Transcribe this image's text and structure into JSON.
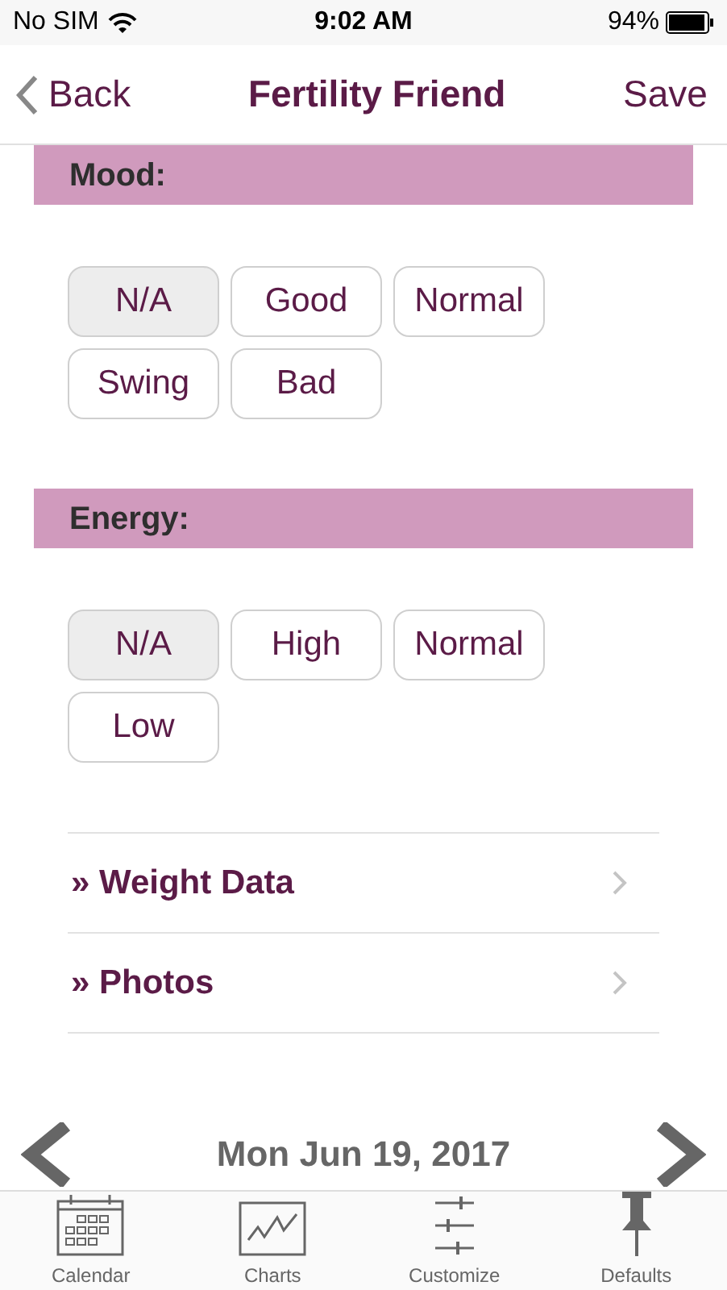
{
  "status_bar": {
    "carrier": "No SIM",
    "time": "9:02 AM",
    "battery": "94%"
  },
  "nav": {
    "back": "Back",
    "title": "Fertility Friend",
    "action": "Save"
  },
  "sections": [
    {
      "title": "Mood:",
      "options": [
        {
          "label": "N/A",
          "selected": true
        },
        {
          "label": "Good",
          "selected": false
        },
        {
          "label": "Normal",
          "selected": false
        },
        {
          "label": "Swing",
          "selected": false
        },
        {
          "label": "Bad",
          "selected": false
        }
      ]
    },
    {
      "title": "Energy:",
      "options": [
        {
          "label": "N/A",
          "selected": true
        },
        {
          "label": "High",
          "selected": false
        },
        {
          "label": "Normal",
          "selected": false
        },
        {
          "label": "Low",
          "selected": false
        }
      ]
    }
  ],
  "links": [
    {
      "label": "» Weight Data"
    },
    {
      "label": "» Photos"
    }
  ],
  "date": "Mon Jun 19, 2017",
  "tabs": [
    {
      "kind": "calendar",
      "label": "Calendar"
    },
    {
      "kind": "chart",
      "label": "Charts"
    },
    {
      "kind": "sliders",
      "label": "Customize"
    },
    {
      "kind": "pin",
      "label": "Defaults"
    }
  ]
}
